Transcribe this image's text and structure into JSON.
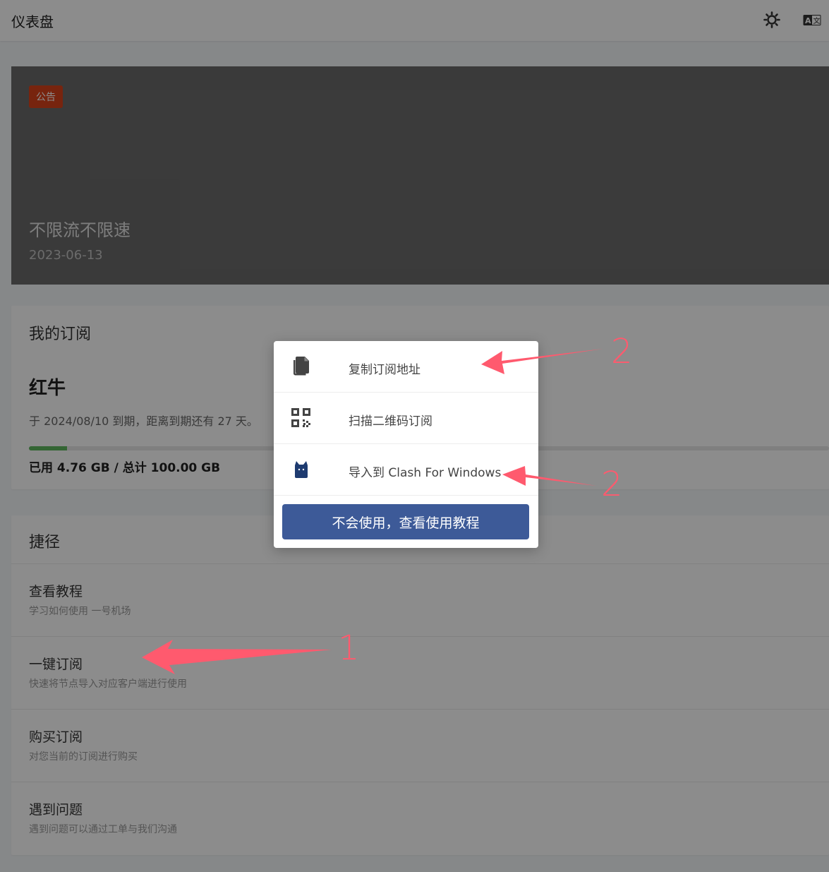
{
  "header": {
    "title": "仪表盘",
    "theme_icon": "sun-icon",
    "lang_icon": "translate-icon"
  },
  "banner": {
    "badge": "公告",
    "title": "不限流不限速",
    "date": "2023-06-13"
  },
  "subscription": {
    "section_title": "我的订阅",
    "plan_name": "红牛",
    "expire_text": "于 2024/08/10 到期，距离到期还有 27 天。",
    "usage_text": "已用 4.76 GB / 总计 100.00 GB",
    "used_fraction": 0.0476,
    "progress_color": "#5fb85f"
  },
  "shortcuts": {
    "section_title": "捷径",
    "items": [
      {
        "title": "查看教程",
        "desc": "学习如何使用 一号机场"
      },
      {
        "title": "一键订阅",
        "desc": "快速将节点导入对应客户端进行使用"
      },
      {
        "title": "购买订阅",
        "desc": "对您当前的订阅进行购买"
      },
      {
        "title": "遇到问题",
        "desc": "遇到问题可以通过工单与我们沟通"
      }
    ]
  },
  "modal": {
    "items": [
      {
        "label": "复制订阅地址",
        "icon": "copy-icon"
      },
      {
        "label": "扫描二维码订阅",
        "icon": "qrcode-icon"
      },
      {
        "label": "导入到 Clash For Windows",
        "icon": "clash-cat-icon"
      }
    ],
    "button_label": "不会使用，查看使用教程",
    "button_color": "#3d5a98"
  },
  "annotations": {
    "color": "#ff5a6e",
    "labels": [
      "1",
      "2",
      "2"
    ]
  }
}
